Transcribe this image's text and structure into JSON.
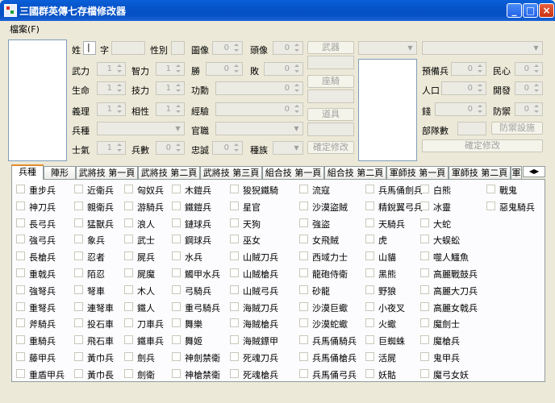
{
  "window": {
    "title": "三國群英傳七存檔修改器"
  },
  "menu": {
    "file": "檔案(F)"
  },
  "general": {
    "surname_label": "姓",
    "surname_value": "|",
    "zi_label": "字",
    "gender_label": "性別",
    "portrait_label": "圖像",
    "portrait_value": "0",
    "head_label": "頭像",
    "head_value": "0",
    "force_label": "武力",
    "force_value": "1",
    "intel_label": "智力",
    "intel_value": "1",
    "win_label": "勝",
    "win_value": "0",
    "lose_label": "敗",
    "lose_value": "0",
    "life_label": "生命",
    "life_value": "1",
    "skill_label": "技力",
    "skill_value": "1",
    "merit_label": "功勳",
    "merit_value": "0",
    "loyalty_label": "義理",
    "loyalty_value": "1",
    "affinity_label": "相性",
    "affinity_value": "1",
    "exp_label": "經驗",
    "exp_value": "0",
    "troop_type_label": "兵種",
    "office_label": "官職",
    "morale_label": "士氣",
    "morale_value": "1",
    "troops_label": "兵數",
    "troops_value": "0",
    "fidelity_label": "忠誠",
    "fidelity_value": "0",
    "race_label": "種族"
  },
  "buttons": {
    "weapon": "武器",
    "mount": "座騎",
    "item": "道具",
    "confirm_general": "確定修改",
    "defense_facility": "防禦設施",
    "confirm_city": "確定修改"
  },
  "city": {
    "reserve_label": "預備兵",
    "reserve_value": "0",
    "people_label": "民心",
    "people_value": "0",
    "population_label": "人口",
    "population_value": "0",
    "develop_label": "開發",
    "develop_value": "0",
    "money_label": "錢",
    "money_value": "0",
    "defense_label": "防禦",
    "defense_value": "0",
    "units_label": "部隊數"
  },
  "tabs": [
    "兵種",
    "陣形",
    "武將技 第一頁",
    "武將技 第二頁",
    "武將技 第三頁",
    "組合技 第一頁",
    "組合技 第二頁",
    "軍師技 第一頁",
    "軍師技 第二頁",
    "軍"
  ],
  "troop_columns": [
    [
      "重步兵",
      "神刀兵",
      "長弓兵",
      "強弓兵",
      "長槍兵",
      "重戟兵",
      "強弩兵",
      "重弩兵",
      "斧騎兵",
      "重騎兵",
      "藤甲兵",
      "重盾甲兵"
    ],
    [
      "近衛兵",
      "親衛兵",
      "猛獸兵",
      "象兵",
      "忍者",
      "陌忍",
      "弩車",
      "連弩車",
      "投石車",
      "飛石車",
      "黃巾兵",
      "黃巾長"
    ],
    [
      "匈奴兵",
      "游騎兵",
      "浪人",
      "武士",
      "屍兵",
      "屍魔",
      "木人",
      "鐵人",
      "刀車兵",
      "鐵車兵",
      "劍兵",
      "劍衛"
    ],
    [
      "木鎧兵",
      "鐵鎧兵",
      "鏈球兵",
      "鋼球兵",
      "水兵",
      "觸甲水兵",
      "弓騎兵",
      "重弓騎兵",
      "舞樂",
      "舞姬",
      "神劍禁衛",
      "神槍禁衛"
    ],
    [
      "狻猊鐵騎",
      "星官",
      "天狗",
      "巫女",
      "山賊刀兵",
      "山賊槍兵",
      "山賊弓兵",
      "海賊刀兵",
      "海賊槍兵",
      "海賊鏢甲",
      "死魂刀兵",
      "死魂槍兵"
    ],
    [
      "流寇",
      "沙漠盜賊",
      "強盜",
      "女飛賊",
      "西域力士",
      "龍砲侍衛",
      "砂龍",
      "沙漠巨蠍",
      "沙漠蛇蠍",
      "兵馬俑騎兵",
      "兵馬俑槍兵",
      "兵馬俑弓兵"
    ],
    [
      "兵馬俑劍兵",
      "精銳翼弓兵",
      "天騎兵",
      "虎",
      "山貓",
      "黑熊",
      "野狼",
      "小夜叉",
      "火蠍",
      "巨蜘蛛",
      "活屍",
      "妖骷"
    ],
    [
      "白熊",
      "冰靈",
      "大蛇",
      "大蜈蚣",
      "噬人鱷魚",
      "高麗戰鼓兵",
      "高麗大刀兵",
      "高麗女戟兵",
      "魔劍士",
      "魔槍兵",
      "鬼甲兵",
      "魔弓女妖"
    ],
    [
      "戰鬼",
      "惡鬼騎兵"
    ]
  ]
}
